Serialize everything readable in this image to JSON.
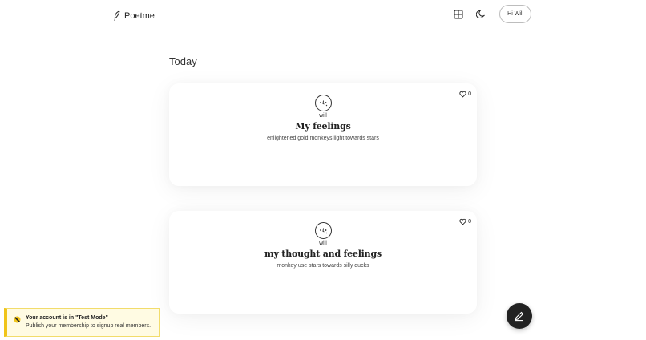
{
  "header": {
    "brand": "Poetme",
    "greeting": "Hi Will"
  },
  "feed": {
    "section_title": "Today",
    "posts": [
      {
        "author": "will",
        "title": "My feelings",
        "text": "enlightened gold monkeys light towards stars",
        "likes": "0"
      },
      {
        "author": "will",
        "title": "my thought and feelings",
        "text": "monkey use stars towards silly ducks",
        "likes": "0"
      }
    ]
  },
  "notice": {
    "title": "Your account is in \"Test Mode\"",
    "body": "Publish your membership to signup real members."
  },
  "icons": {
    "brand": "feather-icon",
    "layout": "grid-icon",
    "theme": "moon-icon",
    "like": "heart-icon",
    "compose": "pencil-icon",
    "notice": "warning-icon"
  },
  "colors": {
    "background": "#ffffff",
    "fab": "#222222",
    "notice_bg": "#fffbe3",
    "notice_border": "#f0c419"
  }
}
